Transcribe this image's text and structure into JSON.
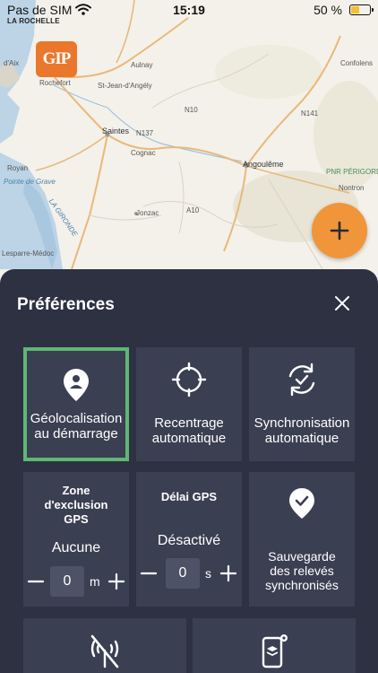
{
  "status_bar": {
    "carrier": "Pas de SIM",
    "location": "LA ROCHELLE",
    "time": "15:19",
    "battery_percent": "50 %",
    "battery_level": 0.5,
    "battery_color": "#f2c12e"
  },
  "app_logo": {
    "text": "GIP",
    "color": "#e9782d"
  },
  "map": {
    "labels": {
      "aulnay": "Aulnay",
      "st_jean": "St-Jean-d'Angély",
      "rochefort": "Rochefort",
      "saintes": "Saintes",
      "cognac": "Cognac",
      "angouleme": "Angoulême",
      "royan": "Royan",
      "pointe_de_grave": "Pointe de Grave",
      "jonzac": "Jonzac",
      "lesparre": "Lesparre-Médoc",
      "gironde": "LA GIRONDE",
      "confolens": "Confolens",
      "nontron": "Nontron",
      "pnr": "PNR PÉRIGORD-L",
      "d_aix": "d'Aix",
      "road_n10": "N10",
      "road_a10": "A10",
      "road_n141": "N141",
      "road_n137": "N137"
    }
  },
  "fab": {
    "icon": "plus-icon",
    "color": "#f0953a"
  },
  "sheet": {
    "title": "Préférences",
    "close_icon": "close-icon",
    "selected_color": "#5fb775",
    "tiles": {
      "geoloc": {
        "label_line1": "Géolocalisation",
        "label_line2": "au démarrage",
        "icon": "user-location-pin-icon",
        "selected": true
      },
      "recenter": {
        "label_line1": "Recentrage",
        "label_line2": "automatique",
        "icon": "crosshair-icon"
      },
      "sync": {
        "label_line1": "Synchronisation",
        "label_line2": "automatique",
        "icon": "sync-check-icon"
      },
      "exclusion": {
        "title_line1": "Zone",
        "title_line2": "d'exclusion",
        "title_line3": "GPS",
        "value": "Aucune",
        "stepper_value": "0",
        "unit": "m"
      },
      "delay": {
        "title": "Délai GPS",
        "value": "Désactivé",
        "stepper_value": "0",
        "unit": "s"
      },
      "backup": {
        "label_line1": "Sauvegarde",
        "label_line2": "des relevés",
        "label_line3": "synchronisés",
        "icon": "location-check-icon"
      },
      "offline": {
        "icon": "no-signal-icon"
      },
      "device": {
        "icon": "phone-settings-icon"
      }
    }
  }
}
